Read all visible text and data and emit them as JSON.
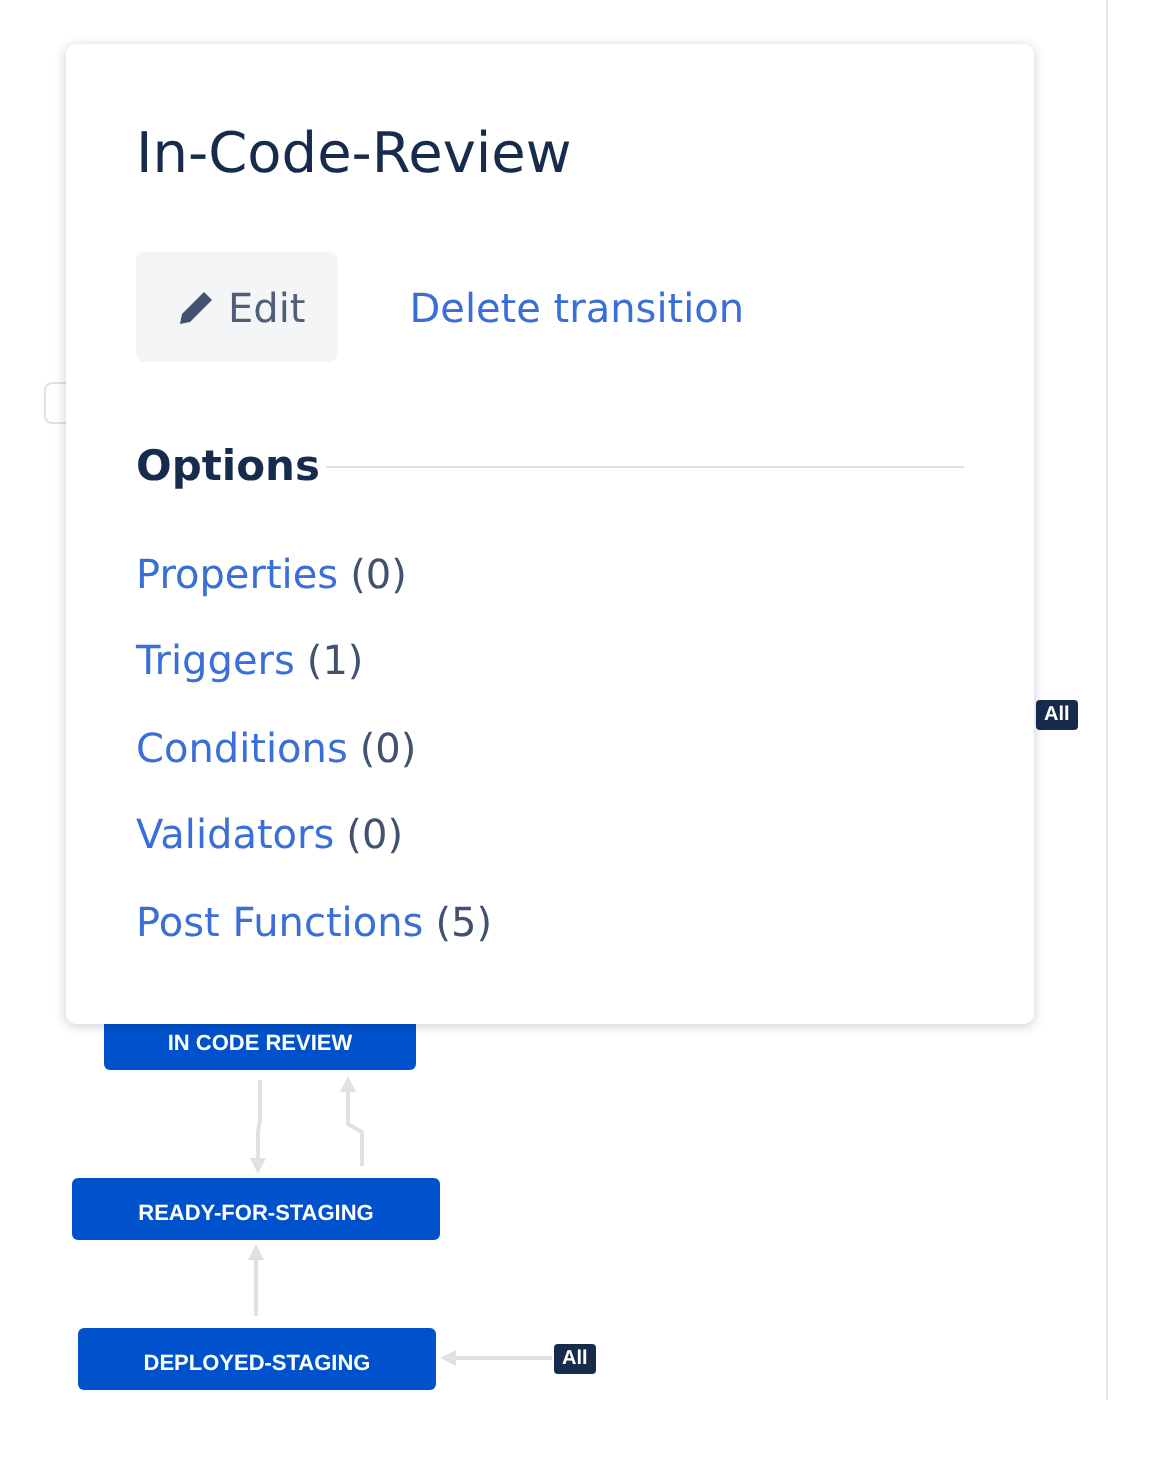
{
  "dialog": {
    "title": "In-Code-Review",
    "edit_button": "Edit",
    "delete_link": "Delete transition",
    "options_heading": "Options",
    "options": [
      {
        "label": "Properties",
        "count": "(0)"
      },
      {
        "label": "Triggers",
        "count": "(1)"
      },
      {
        "label": "Conditions",
        "count": "(0)"
      },
      {
        "label": "Validators",
        "count": "(0)"
      },
      {
        "label": "Post Functions",
        "count": "(5)"
      }
    ]
  },
  "diagram": {
    "nodes": [
      {
        "label": "IN CODE REVIEW"
      },
      {
        "label": "READY-FOR-STAGING"
      },
      {
        "label": "DEPLOYED-STAGING"
      }
    ],
    "badges": [
      {
        "label": "All"
      },
      {
        "label": "All"
      }
    ]
  }
}
